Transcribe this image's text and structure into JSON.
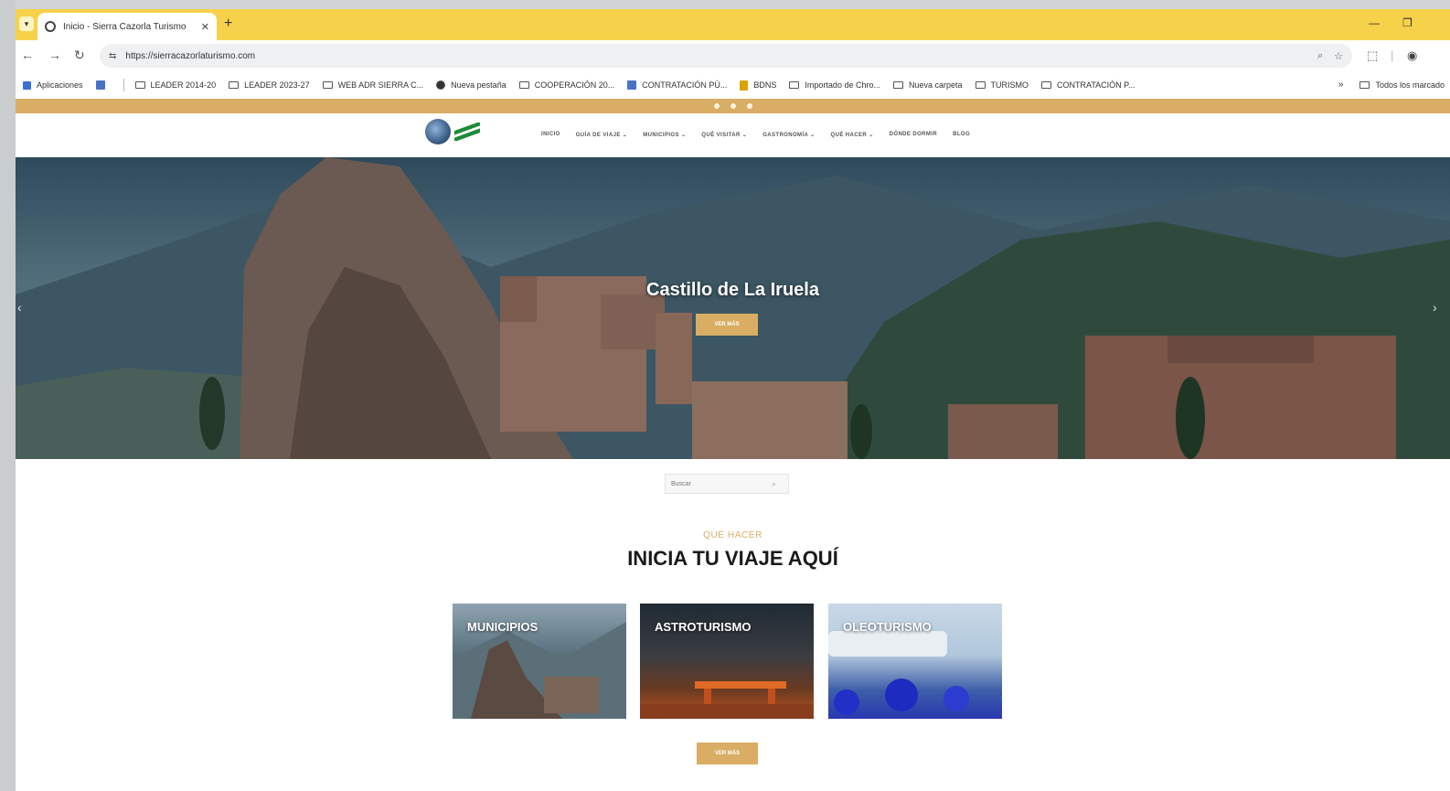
{
  "browser": {
    "tab_title": "Inicio - Sierra Cazorla Turismo",
    "url": "https://sierracazorlaturismo.com",
    "bookmarks": [
      {
        "label": "Aplicaciones",
        "icon": "apps-icon"
      },
      {
        "label": "",
        "icon": "grid-icon"
      },
      {
        "label": "LEADER 2014-20",
        "icon": "folder-icon"
      },
      {
        "label": "LEADER 2023-27",
        "icon": "folder-icon"
      },
      {
        "label": "WEB ADR SIERRA C...",
        "icon": "folder-icon"
      },
      {
        "label": "Nueva pestaña",
        "icon": "globe-icon"
      },
      {
        "label": "COOPERACIÓN 20...",
        "icon": "folder-icon"
      },
      {
        "label": "CONTRATACIÓN PÚ...",
        "icon": "contratacion-icon"
      },
      {
        "label": "BDNS",
        "icon": "bdns-icon"
      },
      {
        "label": "Importado de Chro...",
        "icon": "folder-icon"
      },
      {
        "label": "Nueva carpeta",
        "icon": "folder-icon"
      },
      {
        "label": "TURISMO",
        "icon": "folder-icon"
      },
      {
        "label": "CONTRATACIÓN P...",
        "icon": "folder-icon"
      }
    ],
    "all_bookmarks_label": "Todos los marcado"
  },
  "site": {
    "nav": [
      "INICIO",
      "GUÍA DE VIAJE ⌄",
      "MUNICIPIOS ⌄",
      "QUÉ VISITAR ⌄",
      "GASTRONOMÍA ⌄",
      "QUÉ HACER ⌄",
      "DÓNDE DORMIR",
      "BLOG"
    ],
    "hero": {
      "caption": "Castillo de La Iruela",
      "button": "VER MÁS"
    },
    "search_placeholder": "Buscar",
    "section": {
      "eyebrow": "QUÉ HACER",
      "title": "INICIA TU VIAJE AQUÍ"
    },
    "cards": [
      "MUNICIPIOS",
      "ASTROTURISMO",
      "OLEOTURISMO"
    ],
    "more_button": "VER MÁS"
  }
}
